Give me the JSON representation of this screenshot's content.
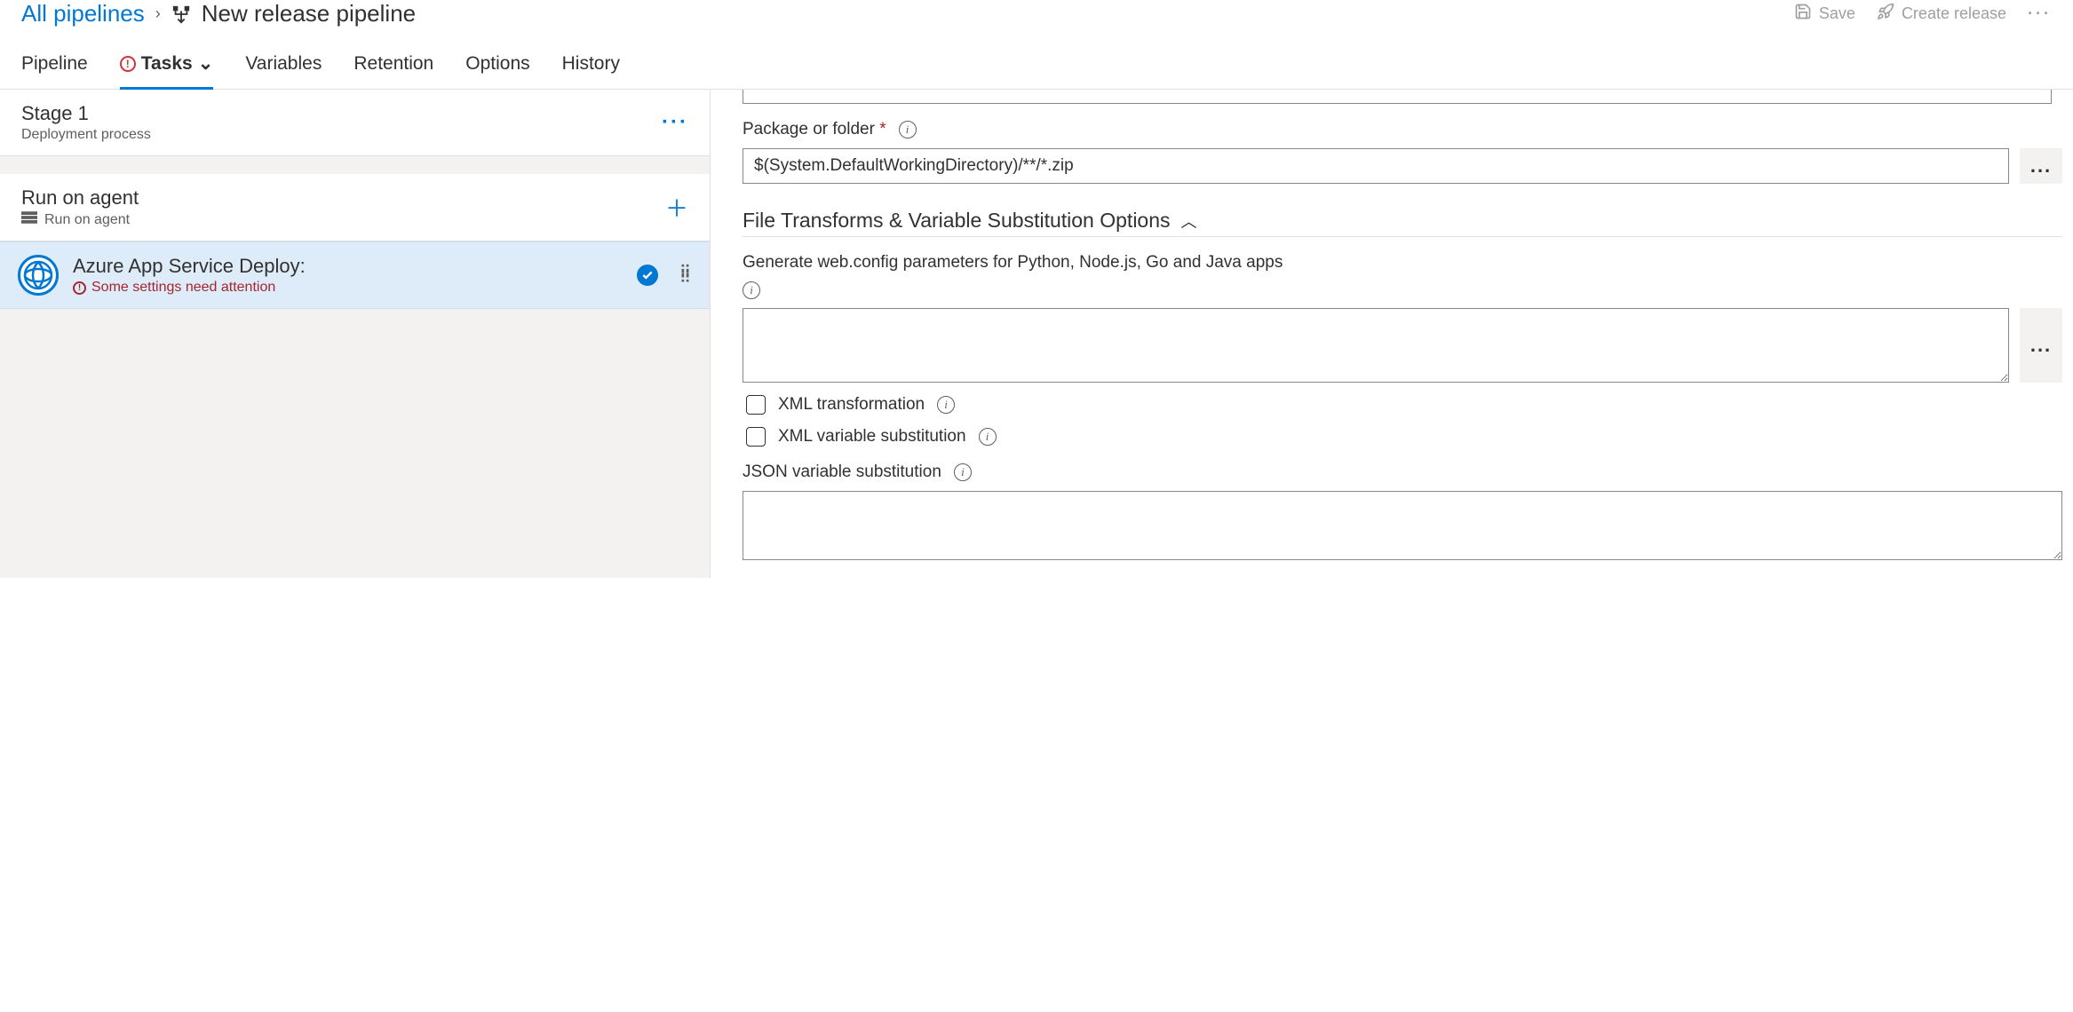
{
  "breadcrumb": {
    "root": "All pipelines",
    "current": "New release pipeline"
  },
  "headerActions": {
    "save": "Save",
    "createRelease": "Create release"
  },
  "tabs": {
    "pipeline": "Pipeline",
    "tasks": "Tasks",
    "variables": "Variables",
    "retention": "Retention",
    "options": "Options",
    "history": "History"
  },
  "stage": {
    "title": "Stage 1",
    "subtitle": "Deployment process"
  },
  "agent": {
    "title": "Run on agent",
    "subtitle": "Run on agent"
  },
  "task": {
    "title": "Azure App Service Deploy:",
    "warning": "Some settings need attention"
  },
  "form": {
    "packageLabel": "Package or folder",
    "packageValue": "$(System.DefaultWorkingDirectory)/**/*.zip",
    "sectionTitle": "File Transforms & Variable Substitution Options",
    "webconfigLabel": "Generate web.config parameters for Python, Node.js, Go and Java apps",
    "webconfigValue": "",
    "xmlTransform": "XML transformation",
    "xmlVarSub": "XML variable substitution",
    "jsonVarSub": "JSON variable substitution",
    "jsonValue": ""
  }
}
